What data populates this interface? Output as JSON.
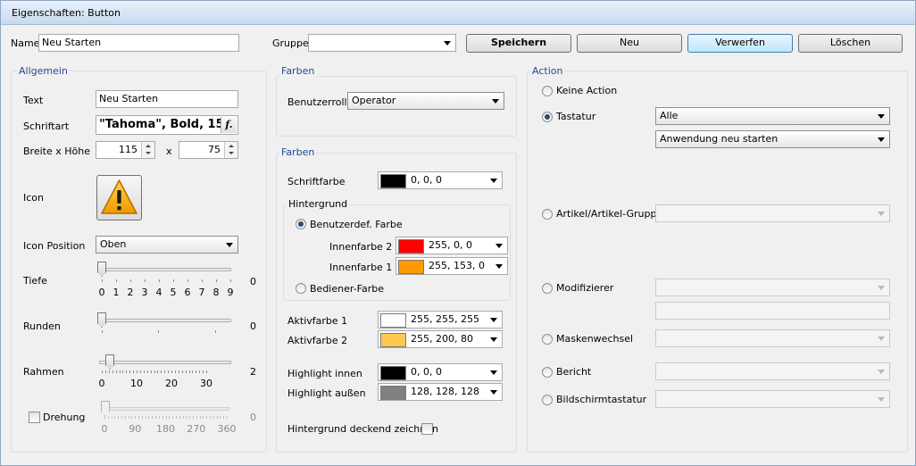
{
  "window": {
    "title": "Eigenschaften: Button"
  },
  "top": {
    "name_label": "Name",
    "name_value": "Neu Starten",
    "group_label": "Gruppe",
    "group_value": "",
    "save": "Speichern",
    "new": "Neu",
    "discard": "Verwerfen",
    "delete": "Löschen"
  },
  "general": {
    "title": "Allgemein",
    "text_label": "Text",
    "text_value": "Neu Starten",
    "font_label": "Schriftart",
    "font_value": "\"Tahoma\", Bold, 15",
    "font_button_icon": "f-icon",
    "size_label": "Breite x Höhe",
    "width": "115",
    "x": "x",
    "height": "75",
    "icon_label": "Icon",
    "icon_name": "warning-triangle-icon",
    "icon_pos_label": "Icon Position",
    "icon_pos_value": "Oben",
    "depth": {
      "label": "Tiefe",
      "value": "0",
      "ticks": [
        "0",
        "1",
        "2",
        "3",
        "4",
        "5",
        "6",
        "7",
        "8",
        "9"
      ]
    },
    "round": {
      "label": "Runden",
      "value": "0"
    },
    "frame": {
      "label": "Rahmen",
      "value": "2",
      "ticks": [
        "0",
        "10",
        "20",
        "30"
      ]
    },
    "rotation": {
      "label": "Drehung",
      "value": "0",
      "ticks": [
        "0",
        "90",
        "180",
        "270",
        "360"
      ]
    }
  },
  "colors1": {
    "title": "Farben",
    "role_label": "Benutzerrolle",
    "role_value": "Operator"
  },
  "colors2": {
    "title": "Farben",
    "font_color_label": "Schriftfarbe",
    "font_color": "0, 0, 0",
    "bg_title": "Hintergrund",
    "custom_color": "Benutzerdef. Farbe",
    "inner2_label": "Innenfarbe 2",
    "inner2": "255, 0, 0",
    "inner1_label": "Innenfarbe 1",
    "inner1": "255, 153, 0",
    "operator_color": "Bediener-Farbe",
    "active1_label": "Aktivfarbe 1",
    "active1": "255, 255, 255",
    "active2_label": "Aktivfarbe 2",
    "active2": "255, 200, 80",
    "hl_inner_label": "Highlight innen",
    "hl_inner": "0, 0, 0",
    "hl_outer_label": "Highlight außen",
    "hl_outer": "128, 128, 128",
    "opaque_label": "Hintergrund deckend zeichnen"
  },
  "swatch_colors": {
    "font": "#000000",
    "inner2": "#ff0000",
    "inner1": "#ff9900",
    "active1": "#ffffff",
    "active2": "#ffc850",
    "hl_inner": "#000000",
    "hl_outer": "#808080"
  },
  "action": {
    "title": "Action",
    "none": "Keine Action",
    "keyboard": "Tastatur",
    "keyboard_value1": "Alle",
    "keyboard_value2": "Anwendung neu starten",
    "article": "Artikel/Artikel-Gruppe",
    "modifier": "Modifizierer",
    "mask": "Maskenwechsel",
    "report": "Bericht",
    "screen_kb": "Bildschirmtastatur"
  }
}
